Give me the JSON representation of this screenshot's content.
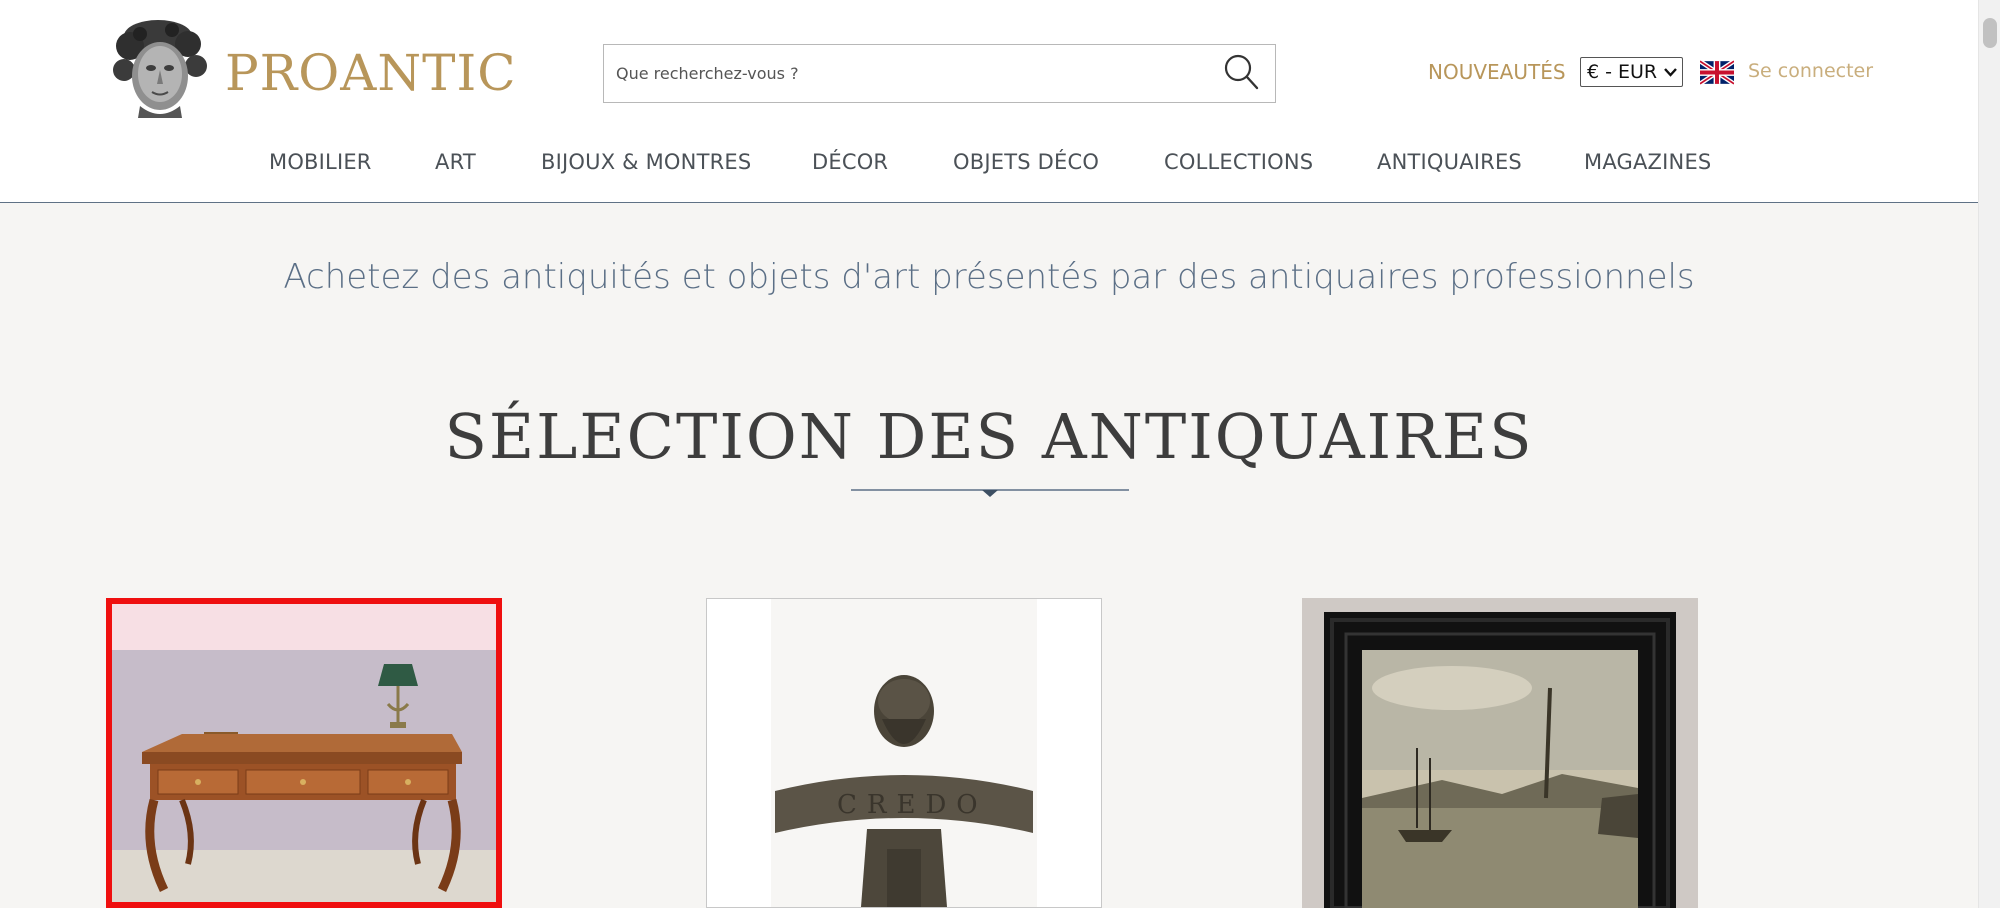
{
  "header": {
    "brand": "PROANTIC",
    "search": {
      "placeholder": "Que recherchez-vous ?"
    },
    "nouveautes_label": "NOUVEAUTÉS",
    "currency": "€ - EUR",
    "login_label": "Se connecter"
  },
  "nav": {
    "items": [
      {
        "label": "MOBILIER"
      },
      {
        "label": "ART"
      },
      {
        "label": "BIJOUX & MONTRES"
      },
      {
        "label": "DÉCOR"
      },
      {
        "label": "OBJETS DÉCO"
      },
      {
        "label": "COLLECTIONS"
      },
      {
        "label": "ANTIQUAIRES"
      },
      {
        "label": "MAGAZINES"
      }
    ]
  },
  "main": {
    "tagline": "Achetez des antiquités et objets d'art présentés par des antiquaires professionnels",
    "section_title": "SÉLECTION DES ANTIQUAIRES"
  },
  "colors": {
    "brand_gold": "#b8965a",
    "nav_text": "#4b5157",
    "tagline_blue": "#5b6f86",
    "selection_red": "#ef0f0f",
    "background": "#f6f5f3"
  },
  "icons": {
    "search": "search-icon",
    "flag": "uk-flag-icon",
    "chevron": "chevron-down-icon",
    "logo": "sculpted-head-logo"
  }
}
